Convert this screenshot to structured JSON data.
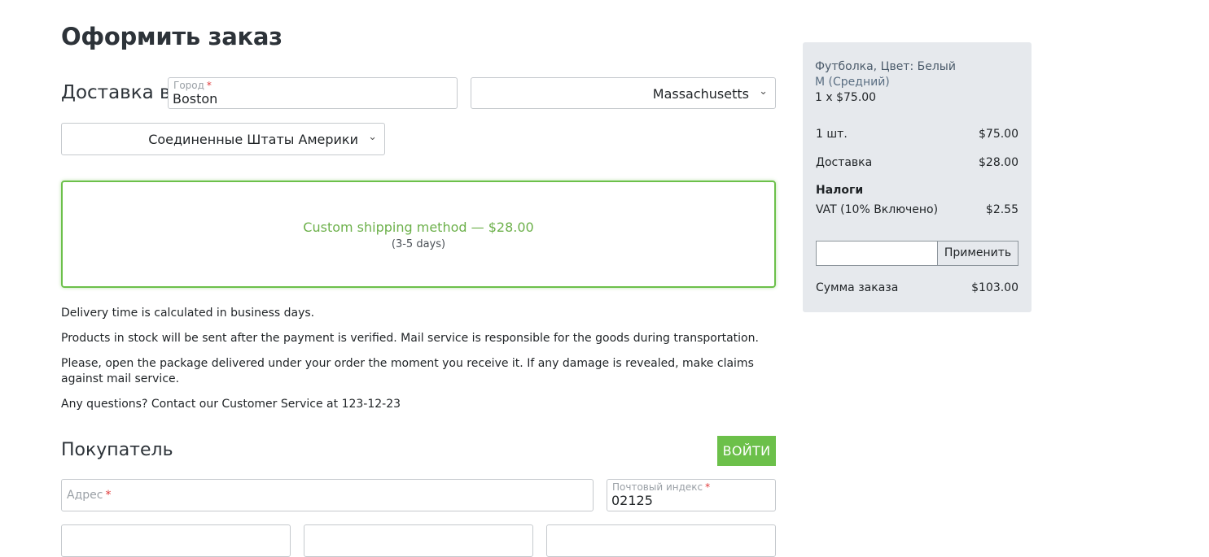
{
  "page": {
    "title": "Оформить заказ"
  },
  "delivery": {
    "label": "Доставка в",
    "city_label": "Город",
    "city_value": "Boston",
    "required_mark": "*",
    "state_value": "Massachusetts",
    "country_value": "Соединенные Штаты Америки"
  },
  "shipping": {
    "method": "Custom shipping method — $28.00",
    "days": "(3-5 days)"
  },
  "notes": [
    "Delivery time is calculated in business days.",
    "Products in stock will be sent after the payment is verified. Mail service is responsible for the goods during transportation.",
    "Please, open the package delivered under your order the moment you receive it. If any damage is revealed, make claims against mail service.",
    "Any questions? Contact our Customer Service at 123-12-23"
  ],
  "customer": {
    "title": "Покупатель",
    "login_label": "ВОЙТИ",
    "address_placeholder": "Адрес",
    "zip_label": "Почтовый индекс",
    "zip_value": "02125"
  },
  "summary": {
    "item_name": "Футболка, Цвет: Белый",
    "item_variant": "M (Средний)",
    "item_qty_price": "1 x $75.00",
    "subtotal_label": "1 шт.",
    "subtotal_value": "$75.00",
    "shipping_label": "Доставка",
    "shipping_value": "$28.00",
    "taxes_label": "Налоги",
    "vat_label": "VAT (10% Включено)",
    "vat_value": "$2.55",
    "coupon_value": "",
    "apply_label": "Применить",
    "total_label": "Сумма заказа",
    "total_value": "$103.00"
  },
  "icons": {
    "select_arrow": "chevron-down-icon"
  },
  "colors": {
    "accent": "#6cc04a",
    "required": "#e03a3a",
    "sidebar_bg": "#e6e9ed"
  }
}
